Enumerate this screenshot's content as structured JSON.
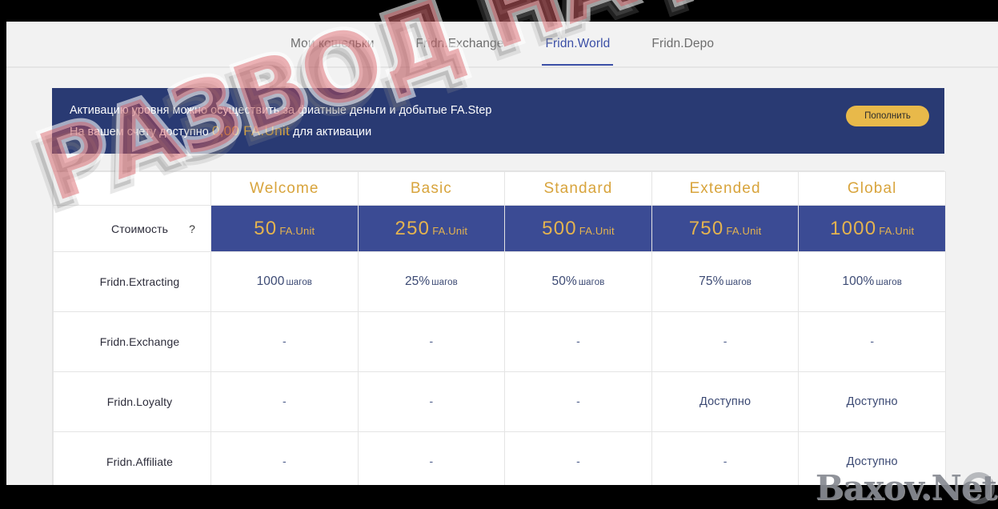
{
  "nav": {
    "tabs": [
      {
        "label": "Мои кошельки",
        "active": false
      },
      {
        "label": "Fridn.Exchange",
        "active": false
      },
      {
        "label": "Fridn.World",
        "active": true
      },
      {
        "label": "Fridn.Depo",
        "active": false
      }
    ]
  },
  "banner": {
    "line1": "Активацию уровня можно осуществить за фиатные деньги и добытые FA.Step",
    "line2_prefix": "На вашем счету доступно",
    "amount": "0,00  FA.Unit",
    "line2_suffix": "для активации",
    "topup_label": "Пополнить",
    "background_color": "#293a73",
    "accent_color": "#e0a32e"
  },
  "table": {
    "tiers": [
      "Welcome",
      "Basic",
      "Standard",
      "Extended",
      "Global"
    ],
    "cost_row": {
      "label": "Стоимость",
      "help": "?",
      "values": [
        "50",
        "250",
        "500",
        "750",
        "1000"
      ],
      "unit": "FA.Unit",
      "background_color": "#3b4b94",
      "text_color": "#e4b34f"
    },
    "rows": [
      {
        "label": "Fridn.Extracting",
        "cells": [
          {
            "main": "1000",
            "sub": "шагов"
          },
          {
            "main": "25%",
            "sub": "шагов"
          },
          {
            "main": "50%",
            "sub": "шагов"
          },
          {
            "main": "75%",
            "sub": "шагов"
          },
          {
            "main": "100%",
            "sub": "шагов"
          }
        ]
      },
      {
        "label": "Fridn.Exchange",
        "cells": [
          {
            "main": "-",
            "sub": ""
          },
          {
            "main": "-",
            "sub": ""
          },
          {
            "main": "-",
            "sub": ""
          },
          {
            "main": "-",
            "sub": ""
          },
          {
            "main": "-",
            "sub": ""
          }
        ]
      },
      {
        "label": "Fridn.Loyalty",
        "cells": [
          {
            "main": "-",
            "sub": ""
          },
          {
            "main": "-",
            "sub": ""
          },
          {
            "main": "-",
            "sub": ""
          },
          {
            "main": "Доступно",
            "sub": ""
          },
          {
            "main": "Доступно",
            "sub": ""
          }
        ]
      },
      {
        "label": "Fridn.Affiliate",
        "cells": [
          {
            "main": "-",
            "sub": ""
          },
          {
            "main": "-",
            "sub": ""
          },
          {
            "main": "-",
            "sub": ""
          },
          {
            "main": "-",
            "sub": ""
          },
          {
            "main": "Доступно",
            "sub": ""
          }
        ]
      }
    ]
  },
  "watermarks": {
    "main": "РАЗВОД НА ДЕНЬГИ",
    "logo": "Baxov.Net"
  }
}
